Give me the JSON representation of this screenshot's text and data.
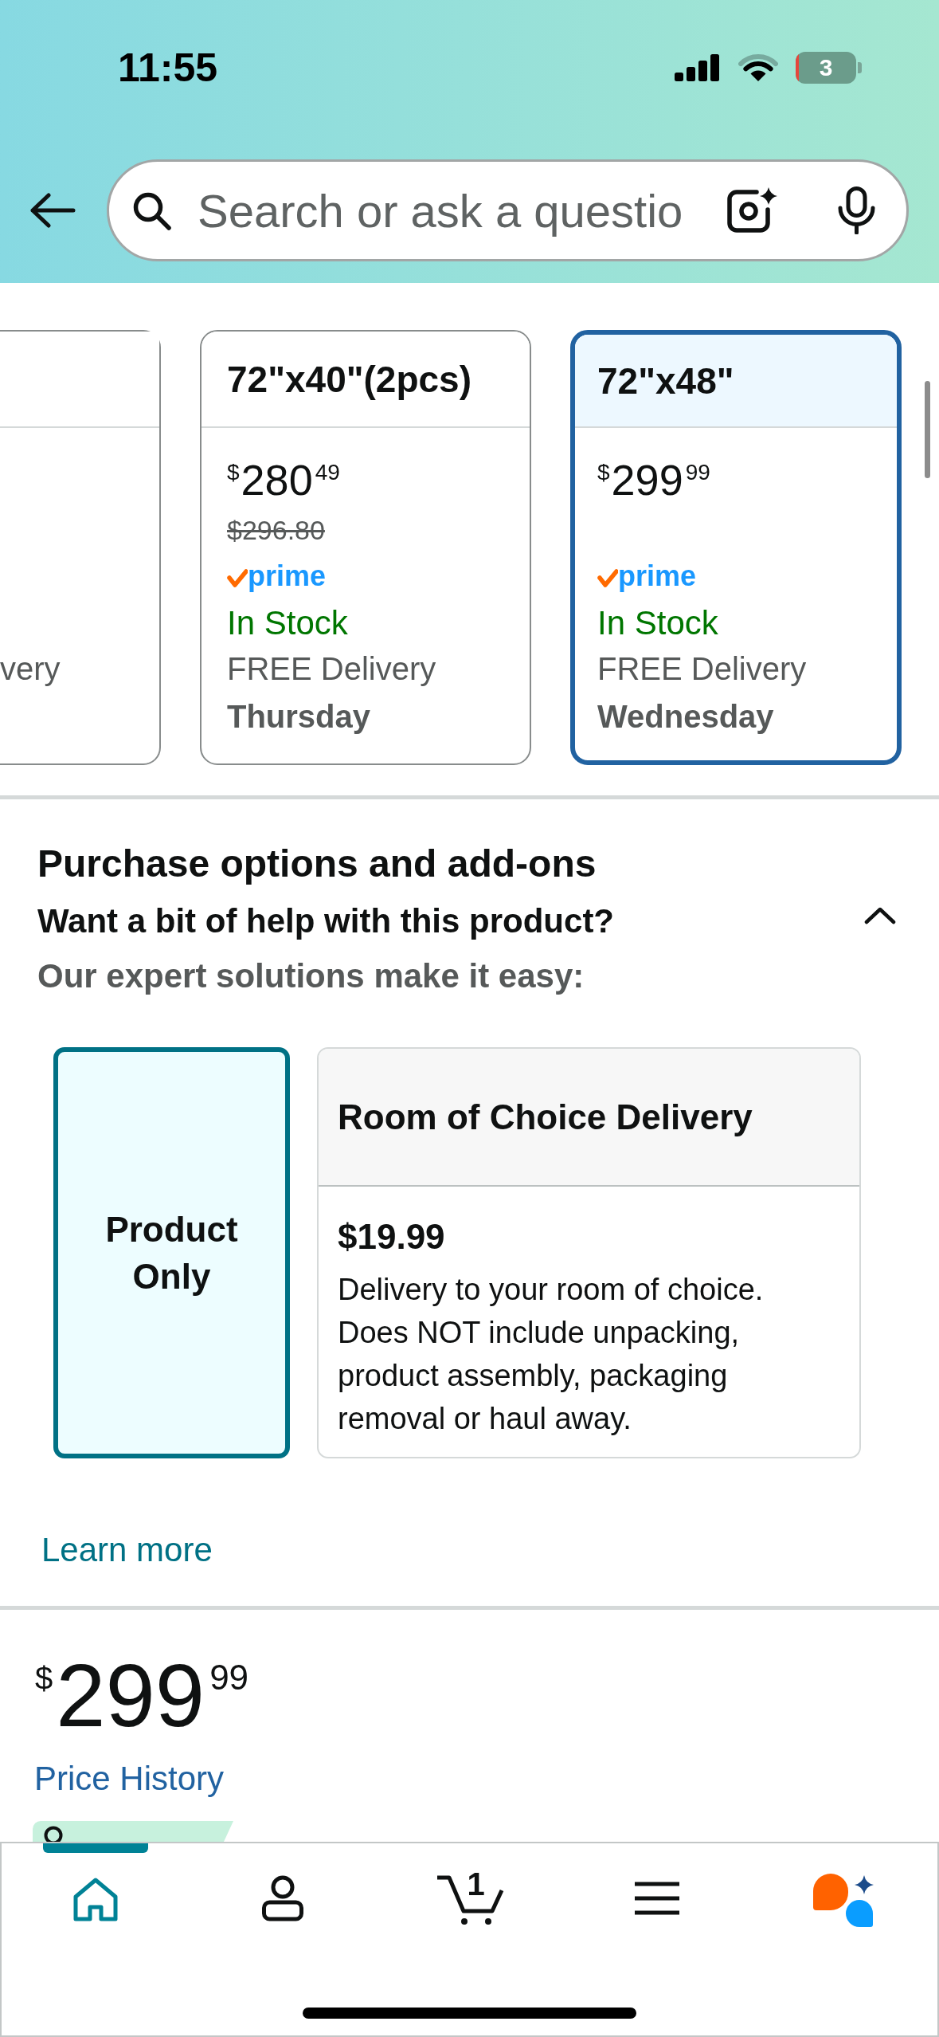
{
  "status_bar": {
    "time": "11:55",
    "battery": "3"
  },
  "search_bar": {
    "placeholder": "Search or ask a questio"
  },
  "size_selector": {
    "options": [
      {
        "kind": "cut",
        "delivery": "very",
        "selected": false
      },
      {
        "kind": "full",
        "title": "72\"x40\"(2pcs)",
        "currency": "$",
        "whole": "280",
        "fraction": "49",
        "list_price": "$296.80",
        "prime": "prime",
        "stock": "In Stock",
        "delivery": "FREE Delivery",
        "day": "Thursday",
        "selected": false
      },
      {
        "kind": "full",
        "title": "72\"x48\"",
        "currency": "$",
        "whole": "299",
        "fraction": "99",
        "prime": "prime",
        "stock": "In Stock",
        "delivery": "FREE Delivery",
        "day": "Wednesday",
        "selected": true
      }
    ]
  },
  "purchase_options": {
    "title": "Purchase options and add-ons",
    "subtitle": "Want a bit of help with this product?",
    "expanded": true,
    "description": "Our expert solutions make it easy:",
    "options": [
      {
        "kind": "simple",
        "title": "Product Only",
        "selected": true
      },
      {
        "kind": "detailed",
        "title": "Room of Choice Delivery",
        "price": "$19.99",
        "description": "Delivery to your room of choice. Does NOT include unpacking, product assembly, packaging removal or haul away.",
        "selected": false
      }
    ],
    "learn_more": "Learn more"
  },
  "price": {
    "currency": "$",
    "whole": "299",
    "fraction": "99",
    "history_link": "Price History"
  },
  "bottom_nav": {
    "items": [
      {
        "kind": "home",
        "selected": true
      },
      {
        "kind": "account",
        "selected": false
      },
      {
        "kind": "cart",
        "count": "1",
        "selected": false
      },
      {
        "kind": "menu",
        "selected": false
      },
      {
        "kind": "assistant",
        "selected": false
      }
    ]
  }
}
